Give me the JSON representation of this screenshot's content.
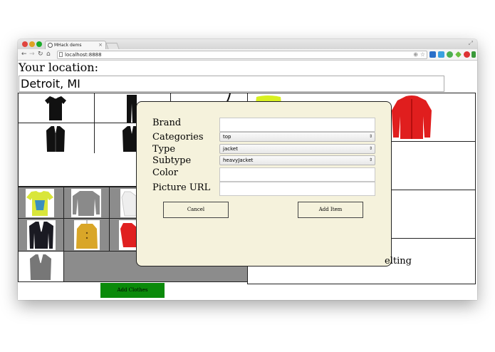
{
  "browser": {
    "tab_title": "MHack dems",
    "tab_close": "×",
    "url": "localhost:8888",
    "colors": {
      "close": "#e0443e",
      "minimize": "#dea123",
      "zoom": "#1aab29"
    }
  },
  "page": {
    "location_label": "Your location:",
    "location_value": "Detroit, MI",
    "partial_text_behind_dialog": "elting",
    "add_clothes_button": "Add Clothes",
    "colors": {
      "add_clothes_bg": "#0a8a0a",
      "gray_cells": "#8c8c8c"
    }
  },
  "catalog": {
    "category_icons": [
      "top-icon",
      "pants-icon",
      "shoe-icon",
      "jacket-icon",
      "coat-icon"
    ],
    "items": [
      "yellow-tshirt",
      "gray-sweater",
      "white-shirt",
      "black-blazer",
      "mustard-coat",
      "red-jacket",
      "gray-blazer",
      "yellow-top",
      "red-parka"
    ]
  },
  "dialog": {
    "brand_label": "Brand",
    "brand_value": "",
    "categories_label": "Categories",
    "categories_value": "top",
    "type_label": "Type",
    "type_value": "jacket",
    "subtype_label": "Subtype",
    "subtype_value": "heavyJacket",
    "color_label": "Color",
    "color_value": "",
    "picture_url_label": "Picture URL",
    "picture_url_value": "",
    "cancel_label": "Cancel",
    "add_item_label": "Add Item",
    "colors": {
      "background": "#f5f2dc"
    }
  }
}
